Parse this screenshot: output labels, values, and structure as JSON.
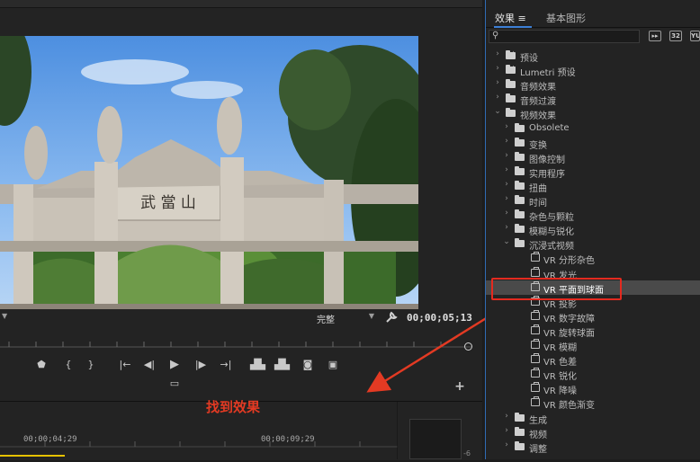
{
  "program_monitor": {
    "resolution": "完整",
    "timecode": "00;00;05;13"
  },
  "transport": {
    "icons": [
      "marker-icon",
      "in-point-icon",
      "out-point-icon",
      "go-to-in-icon",
      "step-back-icon",
      "play-icon",
      "step-forward-icon",
      "go-to-out-icon",
      "lift-icon",
      "extract-icon",
      "export-frame-icon",
      "comparison-view-icon",
      "safe-margins-icon",
      "add-button-icon"
    ]
  },
  "timeline": {
    "time_a": "00;00;04;29",
    "time_b": "00;00;09;29",
    "meter_label": "-6"
  },
  "annotation": {
    "text": "找到效果",
    "color": "#e33a23"
  },
  "effects_panel": {
    "tab_effects": "效果",
    "tab_menu_icon": "≡",
    "tab_graphics": "基本图形",
    "search_placeholder": "",
    "icon_btn_32": "32",
    "icon_btn_yuv": "YUV",
    "tree": [
      {
        "label": "预设",
        "type": "star-folder",
        "level": 0,
        "expanded": false
      },
      {
        "label": "Lumetri 预设",
        "type": "star-folder",
        "level": 0,
        "expanded": false
      },
      {
        "label": "音频效果",
        "type": "folder",
        "level": 0,
        "expanded": false
      },
      {
        "label": "音频过渡",
        "type": "folder",
        "level": 0,
        "expanded": false
      },
      {
        "label": "视频效果",
        "type": "folder",
        "level": 0,
        "expanded": true
      },
      {
        "label": "Obsolete",
        "type": "folder",
        "level": 1,
        "expanded": false
      },
      {
        "label": "变换",
        "type": "folder",
        "level": 1,
        "expanded": false
      },
      {
        "label": "图像控制",
        "type": "folder",
        "level": 1,
        "expanded": false
      },
      {
        "label": "实用程序",
        "type": "folder",
        "level": 1,
        "expanded": false
      },
      {
        "label": "扭曲",
        "type": "folder",
        "level": 1,
        "expanded": false
      },
      {
        "label": "时间",
        "type": "folder",
        "level": 1,
        "expanded": false
      },
      {
        "label": "杂色与颗粒",
        "type": "folder",
        "level": 1,
        "expanded": false
      },
      {
        "label": "模糊与锐化",
        "type": "folder",
        "level": 1,
        "expanded": false
      },
      {
        "label": "沉浸式视频",
        "type": "folder",
        "level": 1,
        "expanded": true
      },
      {
        "label": "VR 分形杂色",
        "type": "effect",
        "level": 2
      },
      {
        "label": "VR 发光",
        "type": "effect",
        "level": 2
      },
      {
        "label": "VR 平面到球面",
        "type": "effect",
        "level": 2,
        "selected": true
      },
      {
        "label": "VR 投影",
        "type": "effect",
        "level": 2
      },
      {
        "label": "VR 数字故障",
        "type": "effect",
        "level": 2
      },
      {
        "label": "VR 旋转球面",
        "type": "effect",
        "level": 2
      },
      {
        "label": "VR 模糊",
        "type": "effect",
        "level": 2
      },
      {
        "label": "VR 色差",
        "type": "effect",
        "level": 2
      },
      {
        "label": "VR 锐化",
        "type": "effect",
        "level": 2
      },
      {
        "label": "VR 降噪",
        "type": "effect",
        "level": 2
      },
      {
        "label": "VR 颜色渐变",
        "type": "effect",
        "level": 2
      },
      {
        "label": "生成",
        "type": "folder",
        "level": 1,
        "expanded": false
      },
      {
        "label": "视频",
        "type": "folder",
        "level": 1,
        "expanded": false
      },
      {
        "label": "调整",
        "type": "folder",
        "level": 1,
        "expanded": false
      }
    ]
  },
  "gateway": {
    "plaque_text": "武 當 山"
  }
}
